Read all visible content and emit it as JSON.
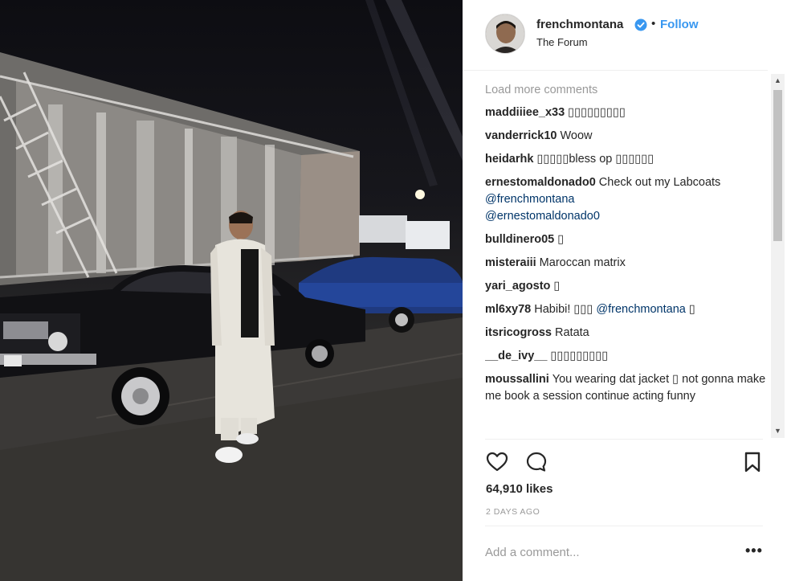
{
  "post": {
    "username": "frenchmontana",
    "verified": true,
    "separator": "•",
    "follow_label": "Follow",
    "location": "The Forum"
  },
  "comments": {
    "load_more": "Load more comments",
    "items": [
      {
        "user": "maddiiiee_x33",
        "text": "▯▯▯▯▯▯▯▯▯"
      },
      {
        "user": "vanderrick10",
        "text": "Woow"
      },
      {
        "user": "heidarhk",
        "text": "▯▯▯▯▯bless op ▯▯▯▯▯▯"
      },
      {
        "user": "ernestomaldonado0",
        "text": "Check out my Labcoats ",
        "mention1": "@frenchmontana",
        "mention2": "@ernestomaldonado0"
      },
      {
        "user": "bulldinero05",
        "text": "▯"
      },
      {
        "user": "misteraiii",
        "text": "Maroccan matrix"
      },
      {
        "user": "yari_agosto",
        "text": "▯"
      },
      {
        "user": "ml6xy78",
        "text": "Habibi! ▯▯▯ ",
        "mention1": "@frenchmontana",
        "tail": " ▯"
      },
      {
        "user": "itsricogross",
        "text": "Ratata"
      },
      {
        "user": "__de_ivy__",
        "text": "▯▯▯▯▯▯▯▯▯"
      },
      {
        "user": "moussallini",
        "text": "You wearing dat jacket ▯ not gonna make me book a session continue acting funny"
      }
    ]
  },
  "actions": {
    "like_icon": "heart-icon",
    "comment_icon": "comment-bubble-icon",
    "save_icon": "bookmark-icon"
  },
  "likes": "64,910 likes",
  "time_ago": "2 DAYS AGO",
  "add_comment_placeholder": "Add a comment...",
  "more_options": "•••",
  "scroll": {
    "up": "▲",
    "down": "▼"
  },
  "colors": {
    "accent": "#3897f0",
    "mention": "#003569",
    "muted": "#999999",
    "text": "#262626"
  }
}
